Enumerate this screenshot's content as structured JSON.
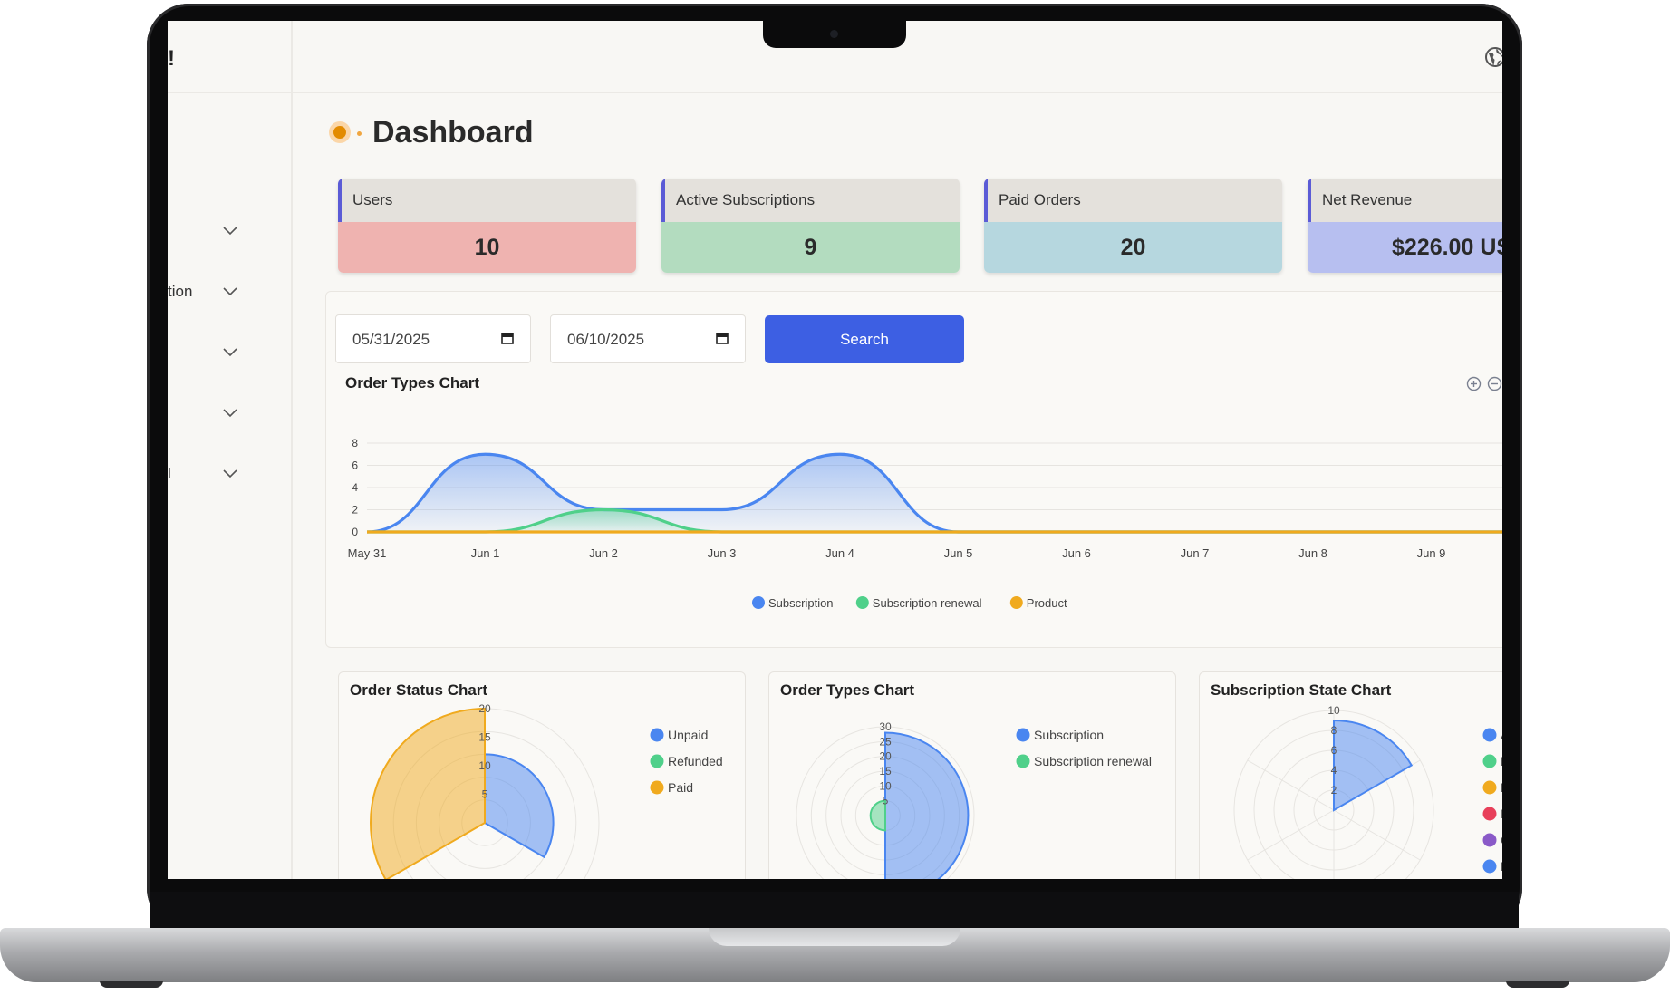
{
  "header": {
    "brand_fragment": "!"
  },
  "sidebar": {
    "items": [
      {
        "label": ""
      },
      {
        "label": "tion"
      },
      {
        "label": ""
      },
      {
        "label": ""
      },
      {
        "label": "l"
      }
    ]
  },
  "page": {
    "title": "Dashboard"
  },
  "stats": [
    {
      "label": "Users",
      "value": "10",
      "color": "#efb3b0"
    },
    {
      "label": "Active Subscriptions",
      "value": "9",
      "color": "#b3dcbf"
    },
    {
      "label": "Paid Orders",
      "value": "20",
      "color": "#b6d7df"
    },
    {
      "label": "Net Revenue",
      "value": "$226.00 US",
      "color": "#b7bff0"
    }
  ],
  "filters": {
    "start_date": "05/31/2025",
    "end_date": "06/10/2025",
    "search_label": "Search"
  },
  "main_chart": {
    "title": "Order Types Chart",
    "chart_data": {
      "type": "area",
      "categories": [
        "May 31",
        "Jun 1",
        "Jun 2",
        "Jun 3",
        "Jun 4",
        "Jun 5",
        "Jun 6",
        "Jun 7",
        "Jun 8",
        "Jun 9"
      ],
      "ylim": [
        0,
        8
      ],
      "yticks": [
        "0",
        "2",
        "4",
        "6",
        "8"
      ],
      "grid": true,
      "legend": "bottom",
      "series": [
        {
          "name": "Subscription",
          "values": [
            0,
            7,
            2,
            2,
            7,
            0,
            0,
            0,
            0,
            0
          ],
          "color": "#4a86f0"
        },
        {
          "name": "Subscription renewal",
          "values": [
            0,
            0,
            2,
            0,
            0,
            0,
            0,
            0,
            0,
            0
          ],
          "color": "#4fd08a"
        },
        {
          "name": "Product",
          "values": [
            0,
            0,
            0,
            0,
            0,
            0,
            0,
            0,
            0,
            0
          ],
          "color": "#f0aa1e"
        }
      ]
    }
  },
  "order_status_chart": {
    "title": "Order Status Chart",
    "chart_data": {
      "type": "polarArea",
      "categories": [
        "Unpaid",
        "Refunded",
        "Paid"
      ],
      "values": [
        12,
        0,
        20
      ],
      "rlim": [
        0,
        20
      ],
      "rticks": [
        "20",
        "15",
        "10",
        "5"
      ],
      "legend": "right",
      "colors": [
        "#4a86f0",
        "#4fd08a",
        "#f0aa1e"
      ]
    }
  },
  "order_types_chart": {
    "title": "Order Types Chart",
    "chart_data": {
      "type": "polarArea",
      "categories": [
        "Subscription",
        "Subscription renewal"
      ],
      "values": [
        28,
        5
      ],
      "rlim": [
        0,
        30
      ],
      "rticks": [
        "30",
        "25",
        "20",
        "15",
        "10",
        "5"
      ],
      "legend": "right",
      "colors": [
        "#4a86f0",
        "#4fd08a"
      ]
    }
  },
  "subscription_state_chart": {
    "title": "Subscription State Chart",
    "chart_data": {
      "type": "polarArea",
      "categories": [
        "A",
        "E",
        "E",
        "I",
        "C",
        "F"
      ],
      "values": [
        9,
        0,
        0,
        0,
        0,
        0
      ],
      "rlim": [
        0,
        10
      ],
      "rticks": [
        "10",
        "8",
        "6",
        "4",
        "2"
      ],
      "legend": "right",
      "colors": [
        "#4a86f0",
        "#4fd08a",
        "#f0aa1e",
        "#e8405a",
        "#8a5ac8",
        "#4a86f0"
      ]
    }
  }
}
